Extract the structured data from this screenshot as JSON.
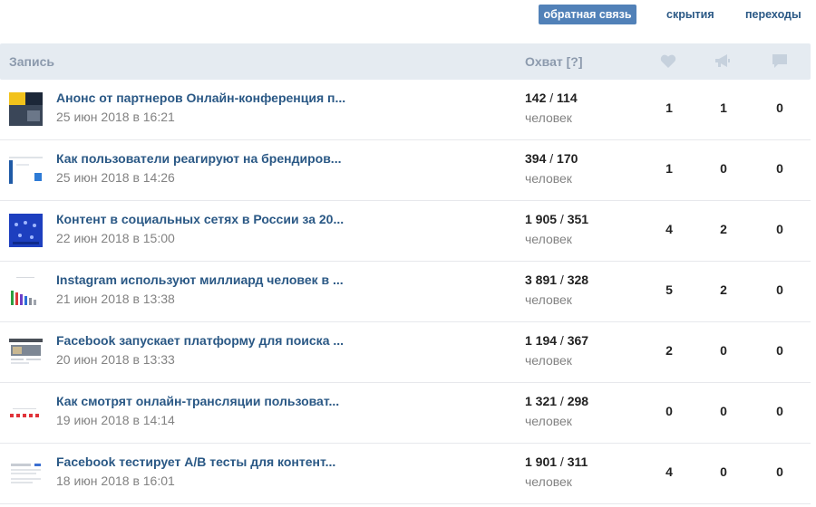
{
  "tabs": {
    "feedback": "обратная связь",
    "hides": "скрытия",
    "transitions": "переходы"
  },
  "header": {
    "post": "Запись",
    "reach": "Охват [?]",
    "like_icon": "heart-icon",
    "share_icon": "megaphone-icon",
    "comment_icon": "comment-icon"
  },
  "colors": {
    "accent": "#5181b8",
    "link": "#2a5885",
    "header_bg": "#e5ebf1",
    "header_text": "#8c9aad",
    "muted": "#828282"
  },
  "posts": [
    {
      "title": "Анонс от партнеров Онлайн-конференция п...",
      "date": "25 июн 2018 в 16:21",
      "reach_total": "142",
      "reach_sub": "114",
      "people": "человек",
      "likes": "1",
      "shares": "1",
      "comments": "0"
    },
    {
      "title": "Как пользователи реагируют на брендиров...",
      "date": "25 июн 2018 в 14:26",
      "reach_total": "394",
      "reach_sub": "170",
      "people": "человек",
      "likes": "1",
      "shares": "0",
      "comments": "0"
    },
    {
      "title": "Контент в социальных сетях в России за 20...",
      "date": "22 июн 2018 в 15:00",
      "reach_total": "1 905",
      "reach_sub": "351",
      "people": "человек",
      "likes": "4",
      "shares": "2",
      "comments": "0"
    },
    {
      "title": "Instagram используют миллиард человек в ...",
      "date": "21 июн 2018 в 13:38",
      "reach_total": "3 891",
      "reach_sub": "328",
      "people": "человек",
      "likes": "5",
      "shares": "2",
      "comments": "0"
    },
    {
      "title": "Facebook запускает платформу для поиска ...",
      "date": "20 июн 2018 в 13:33",
      "reach_total": "1 194",
      "reach_sub": "367",
      "people": "человек",
      "likes": "2",
      "shares": "0",
      "comments": "0"
    },
    {
      "title": "Как смотрят онлайн-трансляции пользоват...",
      "date": "19 июн 2018 в 14:14",
      "reach_total": "1 321",
      "reach_sub": "298",
      "people": "человек",
      "likes": "0",
      "shares": "0",
      "comments": "0"
    },
    {
      "title": "Facebook тестирует A/B тесты для контент...",
      "date": "18 июн 2018 в 16:01",
      "reach_total": "1 901",
      "reach_sub": "311",
      "people": "человек",
      "likes": "4",
      "shares": "0",
      "comments": "0"
    }
  ]
}
